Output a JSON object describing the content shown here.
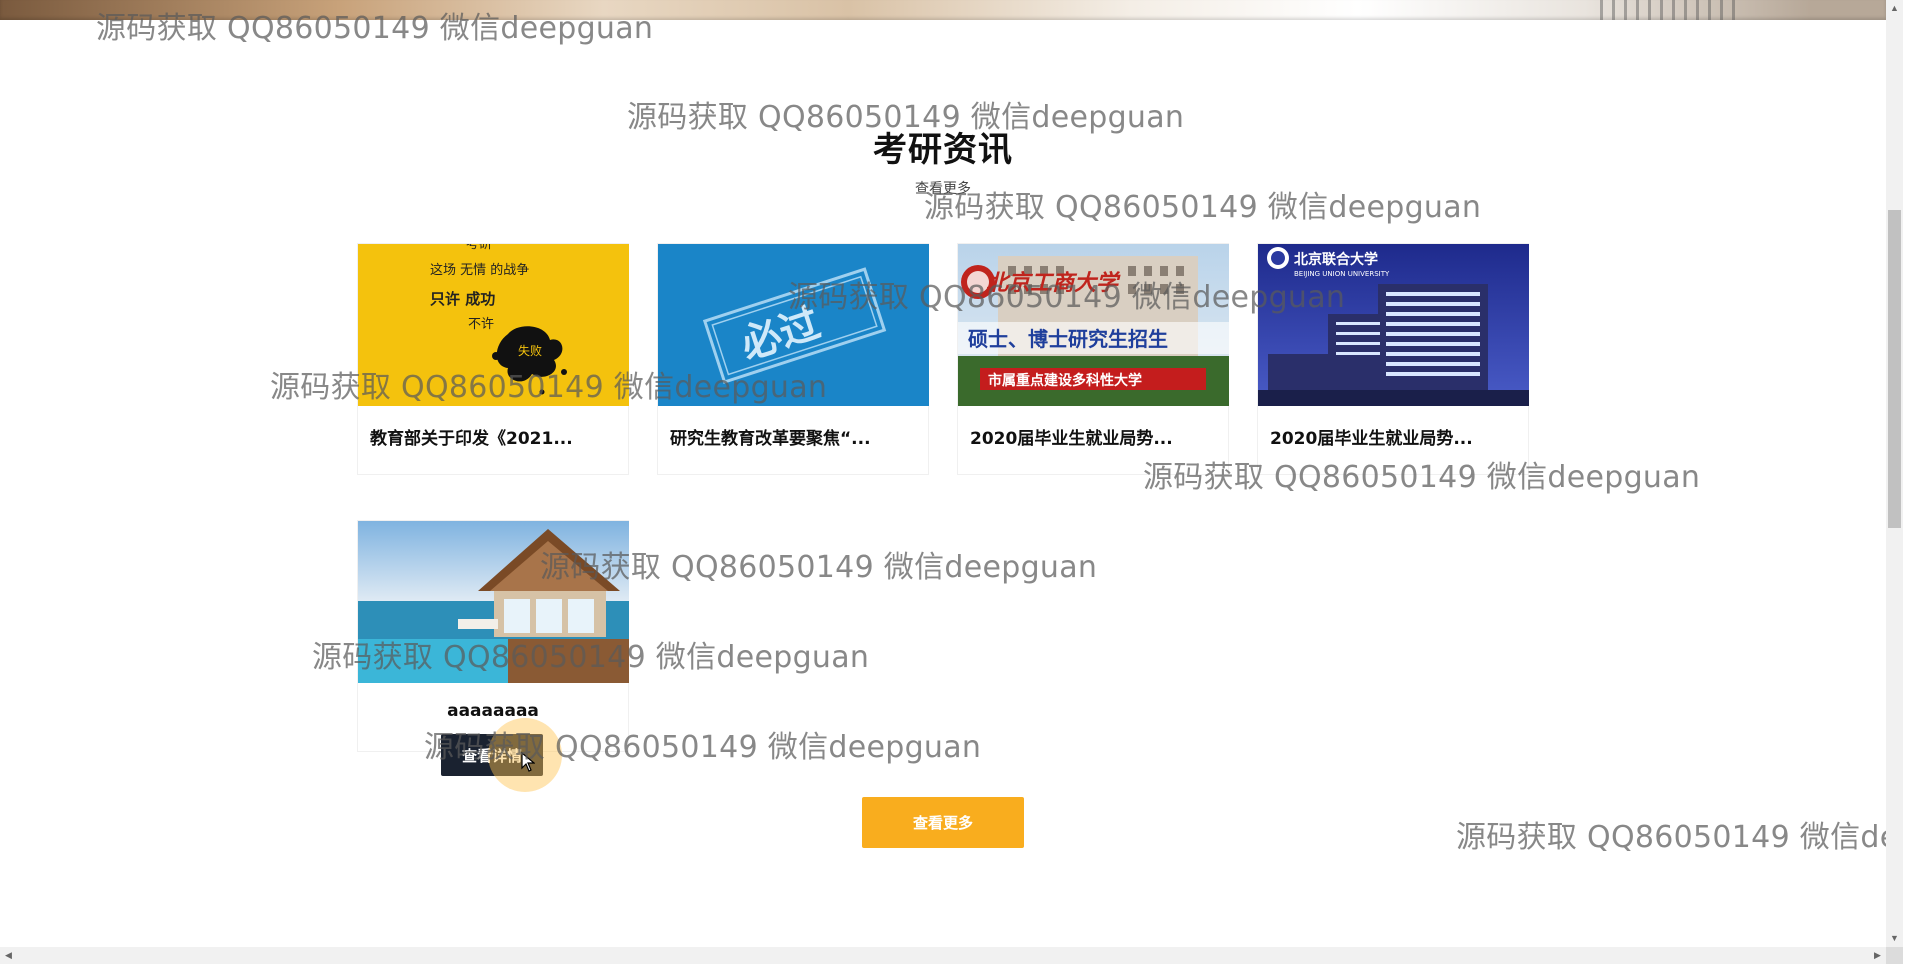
{
  "section": {
    "title": "考研资讯",
    "more_link": "查看更多"
  },
  "cards": [
    {
      "title": "教育部关于印发《2021...",
      "image": "yellow-poster-image",
      "image_text": [
        "考研",
        "这场 无情 的战争",
        "只许 成功",
        "不许",
        "失败"
      ]
    },
    {
      "title": "研究生教育改革要聚焦“...",
      "image": "blue-stamp-image",
      "image_text": [
        "必过"
      ]
    },
    {
      "title": "2020届毕业生就业局势...",
      "image": "university-building-image",
      "image_text": [
        "北京工商大学",
        "硕士、博士研究生招生",
        "市属重点建设多科性大学"
      ]
    },
    {
      "title": "2020届毕业生就业局势...",
      "image": "night-campus-image",
      "image_text": [
        "北京联合大学",
        "BEIJING UNION UNIVERSITY"
      ]
    },
    {
      "title": "aaaaaaaa",
      "image": "seaside-villa-image",
      "image_text": []
    }
  ],
  "buttons": {
    "detail": "查看详情",
    "more": "查看更多"
  },
  "watermark_text": "源码获取 QQ86050149 微信deepguan",
  "icons": {
    "cursor": "mouse-pointer-icon",
    "scroll_up": "▲",
    "scroll_down": "▼",
    "scroll_left": "◀",
    "scroll_right": "▶"
  },
  "colors": {
    "more_button": "#f9ad1e",
    "detail_button": "#1a2230",
    "click_highlight": "#ffc450"
  }
}
